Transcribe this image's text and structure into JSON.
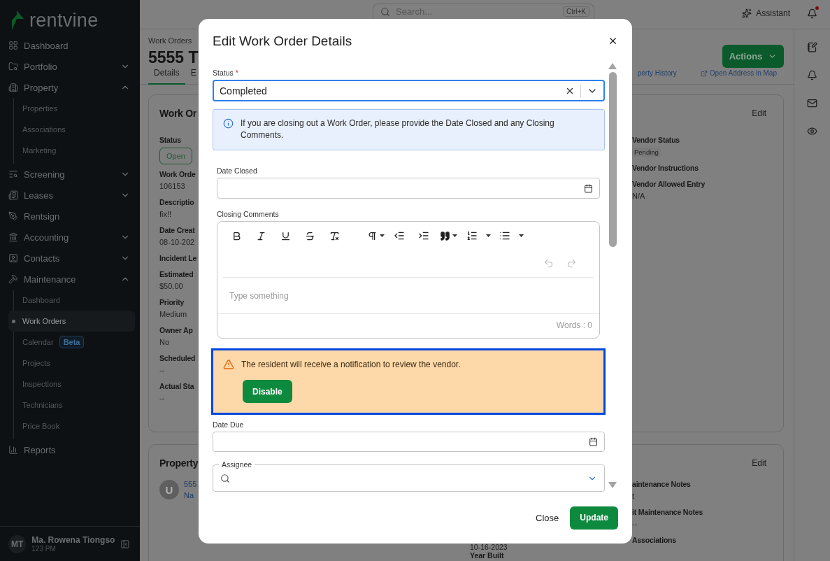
{
  "sidebar": {
    "logo": "rentvine",
    "items": [
      {
        "label": "Dashboard",
        "kind": "link"
      },
      {
        "label": "Portfolio",
        "kind": "group",
        "expanded": false
      },
      {
        "label": "Property",
        "kind": "group",
        "expanded": true,
        "children": [
          {
            "label": "Properties",
            "selected": false
          },
          {
            "label": "Associations",
            "selected": false
          },
          {
            "label": "Marketing",
            "selected": false
          }
        ]
      },
      {
        "label": "Screening",
        "kind": "group",
        "expanded": false
      },
      {
        "label": "Leases",
        "kind": "group",
        "expanded": false
      },
      {
        "label": "Rentsign",
        "kind": "link"
      },
      {
        "label": "Accounting",
        "kind": "group",
        "expanded": false
      },
      {
        "label": "Contacts",
        "kind": "group",
        "expanded": false
      },
      {
        "label": "Maintenance",
        "kind": "group",
        "expanded": true,
        "children": [
          {
            "label": "Dashboard",
            "selected": false
          },
          {
            "label": "Work Orders",
            "selected": true
          },
          {
            "label": "Calendar",
            "selected": false,
            "badge": "Beta"
          },
          {
            "label": "Projects",
            "selected": false
          },
          {
            "label": "Inspections",
            "selected": false
          },
          {
            "label": "Technicians",
            "selected": false
          },
          {
            "label": "Price Book",
            "selected": false
          }
        ]
      },
      {
        "label": "Reports",
        "kind": "link"
      }
    ],
    "user": {
      "initials": "MT",
      "name": "Ma. Rowena Tiongso",
      "subtitle": "123 PM"
    }
  },
  "topbar": {
    "search_placeholder": "Search...",
    "shortcut": "Ctrl+K",
    "assistant": "Assistant",
    "notifications_unread": true
  },
  "page": {
    "breadcrumb": "Work Orders",
    "title": "5555 T",
    "actions": "Actions",
    "tabs": [
      {
        "label": "Details",
        "selected": true
      },
      {
        "label": "E",
        "selected": false
      }
    ],
    "links": [
      {
        "label": "perty History",
        "external": false
      },
      {
        "label": "Open Address in Map",
        "external": true
      }
    ]
  },
  "details_card": {
    "title": "Work Or",
    "edit": "Edit",
    "left": [
      {
        "kind": "label",
        "text": "Status"
      },
      {
        "kind": "status_badge",
        "text": "Open"
      },
      {
        "kind": "label",
        "text": "Work Orde"
      },
      {
        "kind": "value",
        "text": "106153"
      },
      {
        "kind": "label",
        "text": "Descriptio"
      },
      {
        "kind": "value",
        "text": "fix!!"
      },
      {
        "kind": "label",
        "text": "Date Creat"
      },
      {
        "kind": "value",
        "text": "08-10-202"
      },
      {
        "kind": "label",
        "text": "Incident Le"
      },
      {
        "kind": "label",
        "text": "Estimated"
      },
      {
        "kind": "value",
        "text": "$50.00"
      },
      {
        "kind": "label",
        "text": "Priority"
      },
      {
        "kind": "value",
        "text": "Medium"
      },
      {
        "kind": "label",
        "text": "Owner Ap"
      },
      {
        "kind": "value",
        "text": "No"
      },
      {
        "kind": "label",
        "text": "Scheduled"
      },
      {
        "kind": "value",
        "text": "--"
      },
      {
        "kind": "label",
        "text": "Actual Sta"
      },
      {
        "kind": "value",
        "text": "--"
      }
    ],
    "right": [
      {
        "kind": "label",
        "text": "Vendor Status"
      },
      {
        "kind": "tag",
        "text": "Pending"
      },
      {
        "kind": "label",
        "text": "Vendor Instructions"
      },
      {
        "kind": "label",
        "text": "Vendor Allowed Entry"
      },
      {
        "kind": "value",
        "text": "N/A"
      }
    ]
  },
  "property_card": {
    "title": "Property",
    "edit": "Edit",
    "avatar": "U",
    "links": [
      "555",
      "Na"
    ],
    "middle": [
      {
        "kind": "value",
        "text": "10-16-2023"
      },
      {
        "kind": "label",
        "text": "Year Built"
      }
    ],
    "right": [
      {
        "kind": "label",
        "text": "aintenance Notes"
      },
      {
        "kind": "value",
        "text": "t"
      },
      {
        "kind": "label",
        "text": "it Maintenance Notes"
      },
      {
        "kind": "value",
        "text": "--"
      },
      {
        "kind": "label",
        "text": "Associations"
      }
    ]
  },
  "modal": {
    "title": "Edit Work Order Details",
    "status": {
      "label": "Status",
      "required_mark": "*",
      "value": "Completed",
      "focused": true
    },
    "info": "If you are closing out a Work Order, please provide the Date Closed and any Closing Comments.",
    "date_closed": {
      "label": "Date Closed"
    },
    "closing_comments": {
      "label": "Closing Comments",
      "placeholder": "Type something",
      "word_count": "Words : 0"
    },
    "notice": {
      "text": "The resident will receive a notification to review the vendor.",
      "button": "Disable",
      "focused": true
    },
    "date_due": {
      "label": "Date Due"
    },
    "assignee": {
      "label": "Assignee"
    },
    "buttons": [
      {
        "label": "Close",
        "kind": "text"
      },
      {
        "label": "Update",
        "kind": "primary"
      }
    ]
  }
}
